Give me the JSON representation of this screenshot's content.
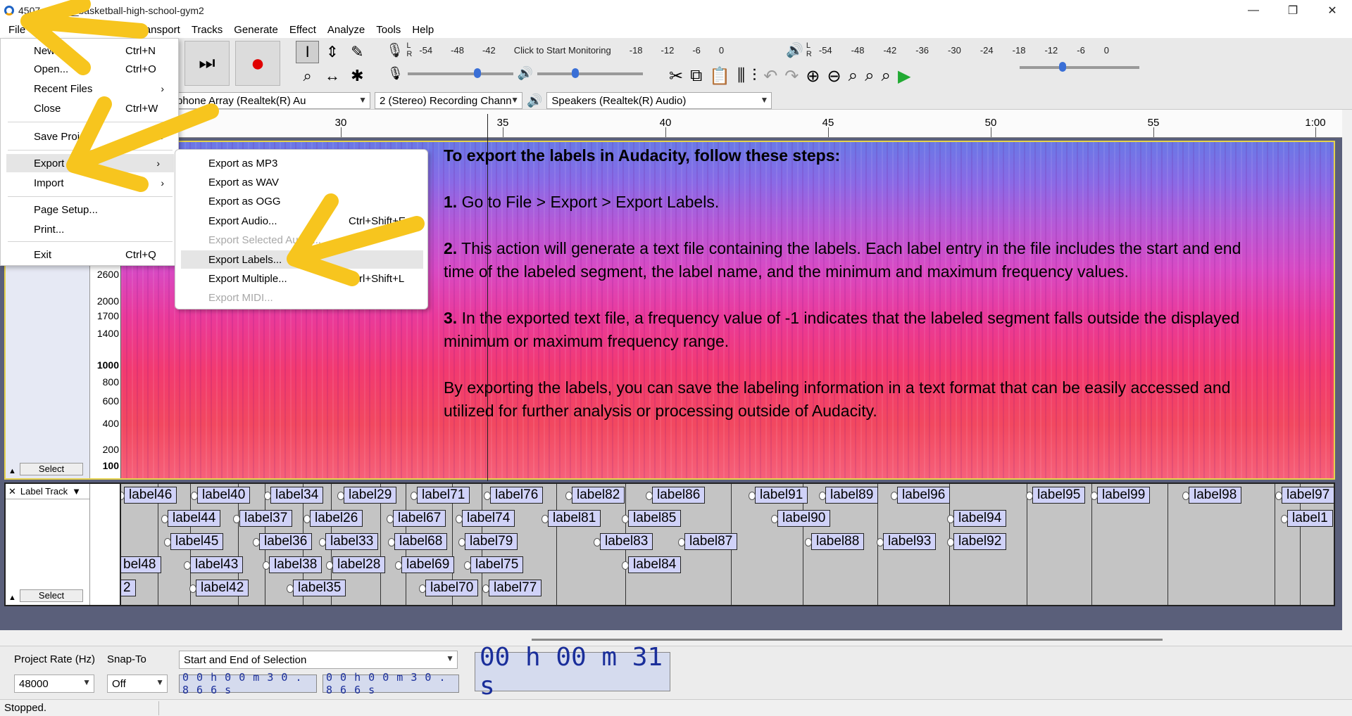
{
  "window": {
    "title": "4507‌…yles__basketball-high-school-gym2",
    "controls": [
      "—",
      "❐",
      "✕"
    ]
  },
  "menubar": [
    "File",
    "Transport",
    "Tracks",
    "Generate",
    "Effect",
    "Analyze",
    "Tools",
    "Help"
  ],
  "record_meter": {
    "ticks": [
      "-54",
      "-48",
      "-42",
      "Click to Start Monitoring",
      "-18",
      "-12",
      "-6",
      "0"
    ],
    "channels": [
      "L",
      "R"
    ]
  },
  "playback_meter": {
    "ticks": [
      "-54",
      "-48",
      "-42",
      "-36",
      "-30",
      "-24",
      "-18",
      "-12",
      "-6",
      "0"
    ],
    "channels": [
      "L",
      "R"
    ]
  },
  "sliders": {
    "record_volume": 0.66,
    "playback_volume": 0.36,
    "play_at_speed": 0.36
  },
  "devices": {
    "input": "phone Array (Realtek(R) Au",
    "channels": "2 (Stereo) Recording Chann",
    "output": "Speakers (Realtek(R) Audio)"
  },
  "ruler": [
    "30",
    "35",
    "40",
    "45",
    "50",
    "55",
    "1:00"
  ],
  "vscale": [
    {
      "v": "2600",
      "bold": false
    },
    {
      "v": "2000",
      "bold": false
    },
    {
      "v": "1700",
      "bold": false
    },
    {
      "v": "1400",
      "bold": false
    },
    {
      "v": "1000",
      "bold": true
    },
    {
      "v": "800",
      "bold": false
    },
    {
      "v": "600",
      "bold": false
    },
    {
      "v": "400",
      "bold": false
    },
    {
      "v": "200",
      "bold": false
    },
    {
      "v": "100",
      "bold": true
    }
  ],
  "track_select": "Select",
  "label_track": {
    "name": "Label Track",
    "select": "Select",
    "labels": [
      {
        "t": "label46",
        "row": 0
      },
      {
        "t": "label40",
        "row": 0
      },
      {
        "t": "label34",
        "row": 0
      },
      {
        "t": "label29",
        "row": 0
      },
      {
        "t": "label71",
        "row": 0
      },
      {
        "t": "label76",
        "row": 0
      },
      {
        "t": "label82",
        "row": 0
      },
      {
        "t": "label86",
        "row": 0
      },
      {
        "t": "label91",
        "row": 0
      },
      {
        "t": "label89",
        "row": 0
      },
      {
        "t": "label96",
        "row": 0
      },
      {
        "t": "label95",
        "row": 0
      },
      {
        "t": "label99",
        "row": 0
      },
      {
        "t": "label98",
        "row": 0
      },
      {
        "t": "label97",
        "row": 0
      },
      {
        "t": "label44",
        "row": 1
      },
      {
        "t": "label37",
        "row": 1
      },
      {
        "t": "label26",
        "row": 1
      },
      {
        "t": "label67",
        "row": 1
      },
      {
        "t": "label74",
        "row": 1
      },
      {
        "t": "label81",
        "row": 1
      },
      {
        "t": "label85",
        "row": 1
      },
      {
        "t": "label90",
        "row": 1
      },
      {
        "t": "label94",
        "row": 1
      },
      {
        "t": "label1",
        "row": 1
      },
      {
        "t": "label45",
        "row": 2
      },
      {
        "t": "label36",
        "row": 2
      },
      {
        "t": "label33",
        "row": 2
      },
      {
        "t": "label68",
        "row": 2
      },
      {
        "t": "label79",
        "row": 2
      },
      {
        "t": "label83",
        "row": 2
      },
      {
        "t": "label87",
        "row": 2
      },
      {
        "t": "label88",
        "row": 2
      },
      {
        "t": "label93",
        "row": 2
      },
      {
        "t": "label92",
        "row": 2
      },
      {
        "t": "bel48",
        "row": 3
      },
      {
        "t": "label43",
        "row": 3
      },
      {
        "t": "label38",
        "row": 3
      },
      {
        "t": "label28",
        "row": 3
      },
      {
        "t": "label69",
        "row": 3
      },
      {
        "t": "label75",
        "row": 3
      },
      {
        "t": "label84",
        "row": 3
      },
      {
        "t": "2",
        "row": 4
      },
      {
        "t": "label42",
        "row": 4
      },
      {
        "t": "label35",
        "row": 4
      },
      {
        "t": "label70",
        "row": 4
      },
      {
        "t": "label77",
        "row": 4
      }
    ]
  },
  "instructions": {
    "heading": "To export the labels in Audacity, follow these steps:",
    "steps": [
      {
        "num": "1.",
        "text": " Go to File > Export > Export Labels."
      },
      {
        "num": "2.",
        "text": " This action will generate a text file containing the labels. Each label entry in the file includes the start and end time of the labeled segment, the label name, and the minimum and maximum frequency values."
      },
      {
        "num": "3.",
        "text": " In the exported text file, a frequency value of -1 indicates that the labeled segment falls outside the displayed minimum or maximum frequency range."
      }
    ],
    "closing": "By exporting the labels, you can save the labeling information in a text format that can be easily accessed and utilized for further analysis or processing outside of Audacity."
  },
  "file_menu": {
    "items": [
      {
        "label": "New",
        "shortcut": "Ctrl+N"
      },
      {
        "label": "Open...",
        "shortcut": "Ctrl+O"
      },
      {
        "label": "Recent Files",
        "submenu": true
      },
      {
        "label": "Close",
        "shortcut": "Ctrl+W"
      },
      {
        "label": "Save Project",
        "submenu": true
      },
      {
        "label": "Export",
        "submenu": true,
        "highlight": true
      },
      {
        "label": "Import",
        "submenu": true
      },
      {
        "label": "Page Setup..."
      },
      {
        "label": "Print..."
      },
      {
        "label": "Exit",
        "shortcut": "Ctrl+Q"
      }
    ]
  },
  "export_menu": {
    "items": [
      {
        "label": "Export as MP3"
      },
      {
        "label": "Export as WAV"
      },
      {
        "label": "Export as OGG"
      },
      {
        "label": "Export Audio...",
        "shortcut": "Ctrl+Shift+E"
      },
      {
        "label": "Export Selected Audio...",
        "disabled": true
      },
      {
        "label": "Export Labels...",
        "highlight": true
      },
      {
        "label": "Export Multiple...",
        "shortcut": "Ctrl+Shift+L"
      },
      {
        "label": "Export MIDI...",
        "disabled": true
      }
    ]
  },
  "selection_toolbar": {
    "project_rate_label": "Project Rate (Hz)",
    "project_rate": "48000",
    "snap_to_label": "Snap-To",
    "snap_to": "Off",
    "selection_mode": "Start and End of Selection",
    "start_time": "0 0 h 0 0 m 3 0 . 8 6 6 s",
    "end_time": "0 0 h 0 0 m 3 0 . 8 6 6 s",
    "audio_position": "00 h 00 m 31 s"
  },
  "status": "Stopped.",
  "colors": {
    "annotation_arrow": "#f7c51e",
    "spectrogram_top": "#6a78e6",
    "spectrogram_bottom": "#f24860",
    "label_fill": "#d0d2f8",
    "time_text": "#1a2e9a",
    "record_button": "#e00000",
    "play_green": "#22aa33"
  }
}
